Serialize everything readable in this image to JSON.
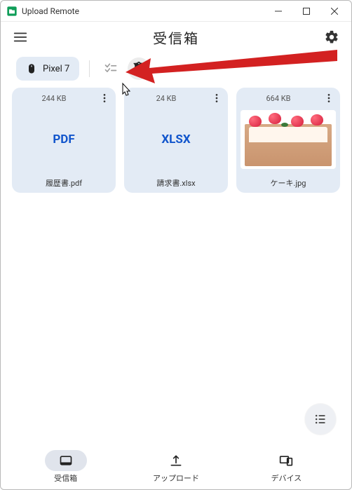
{
  "window": {
    "title": "Upload Remote"
  },
  "toolbar": {
    "page_title": "受信箱"
  },
  "filters": {
    "device_chip": "Pixel 7"
  },
  "files": [
    {
      "size": "244 KB",
      "badge": "PDF",
      "name": "履歴書.pdf",
      "thumb": false
    },
    {
      "size": "24 KB",
      "badge": "XLSX",
      "name": "請求書.xlsx",
      "thumb": false
    },
    {
      "size": "664 KB",
      "badge": "",
      "name": "ケーキ.jpg",
      "thumb": true
    }
  ],
  "bottomnav": {
    "inbox": "受信箱",
    "upload": "アップロード",
    "devices": "デバイス"
  }
}
